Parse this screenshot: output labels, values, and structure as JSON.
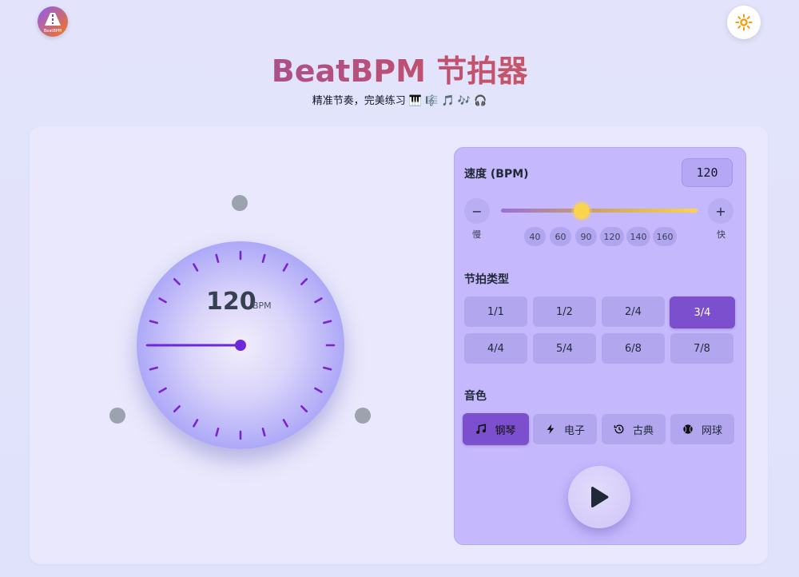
{
  "app": {
    "logo_text": "BeatBPM",
    "title": "BeatBPM 节拍器",
    "subtitle": "精准节奏，完美练习 🎹 🎼 🎵 🎶 🎧"
  },
  "dial": {
    "bpm_value": "120",
    "bpm_unit": "BPM"
  },
  "panel": {
    "speed_label": "速度 (BPM)",
    "bpm_input_value": "120",
    "minus_label": "−",
    "plus_label": "+",
    "slow_label": "慢",
    "fast_label": "快",
    "slider_level": 0.41,
    "presets": [
      "40",
      "60",
      "90",
      "120",
      "140",
      "160"
    ],
    "time_sig_label": "节拍类型",
    "time_signatures": [
      "1/1",
      "1/2",
      "2/4",
      "3/4",
      "4/4",
      "5/4",
      "6/8",
      "7/8"
    ],
    "active_time_signature": "3/4",
    "sound_label": "音色",
    "sounds": [
      {
        "label": "钢琴",
        "icon": "music-note-icon"
      },
      {
        "label": "电子",
        "icon": "lightning-icon"
      },
      {
        "label": "古典",
        "icon": "history-icon"
      },
      {
        "label": "网球",
        "icon": "ball-icon"
      }
    ],
    "active_sound": "钢琴"
  },
  "colors": {
    "accent": "#7c4fce",
    "slider_thumb": "#fcd34d",
    "panel_bg": "#c5b8fd"
  }
}
